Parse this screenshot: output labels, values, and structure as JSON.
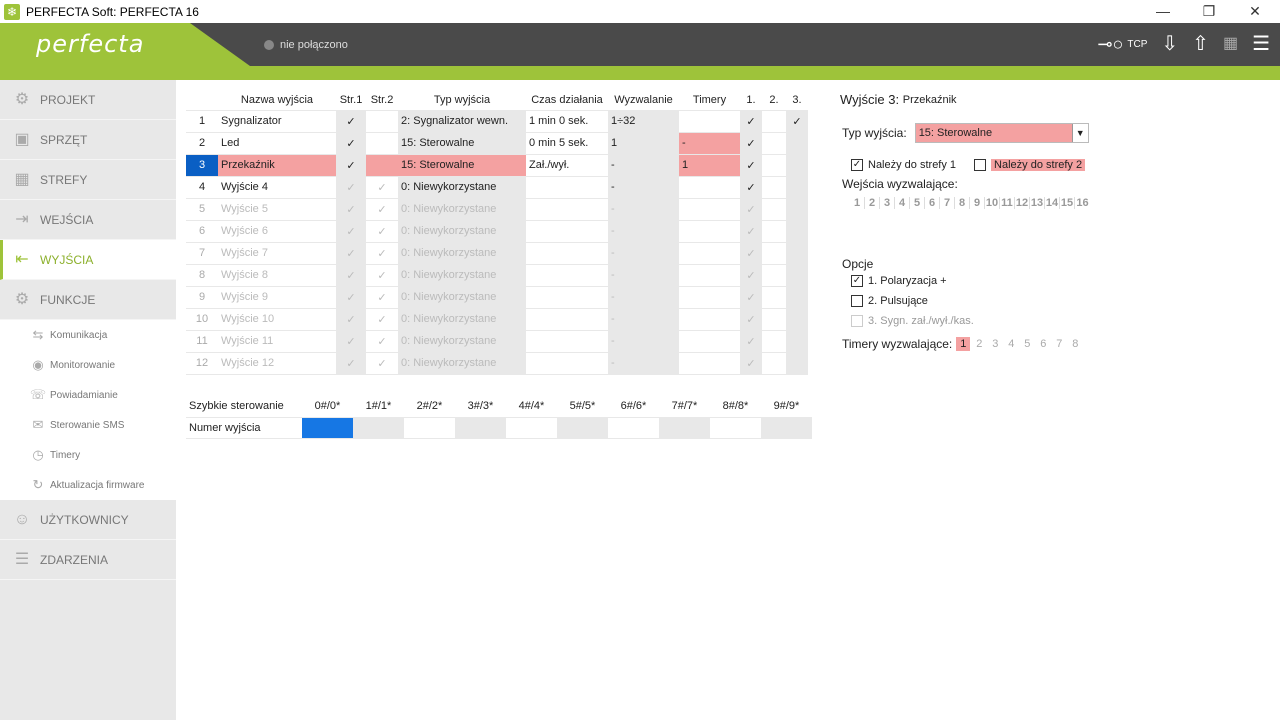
{
  "window": {
    "title": "PERFECTA Soft: PERFECTA 16"
  },
  "header": {
    "logo": "perfecta",
    "status": "nie połączono",
    "tcp_label": "TCP"
  },
  "sidebar": {
    "items": [
      {
        "label": "PROJEKT"
      },
      {
        "label": "SPRZĘT"
      },
      {
        "label": "STREFY"
      },
      {
        "label": "WEJŚCIA"
      },
      {
        "label": "WYJŚCIA"
      },
      {
        "label": "FUNKCJE"
      }
    ],
    "subitems": [
      {
        "label": "Komunikacja"
      },
      {
        "label": "Monitorowanie"
      },
      {
        "label": "Powiadamianie"
      },
      {
        "label": "Sterowanie SMS"
      },
      {
        "label": "Timery"
      },
      {
        "label": "Aktualizacja firmware"
      }
    ],
    "bottom": [
      {
        "label": "UŻYTKOWNICY"
      },
      {
        "label": "ZDARZENIA"
      }
    ]
  },
  "outputs_table": {
    "headers": [
      "",
      "Nazwa wyjścia",
      "Str.1",
      "Str.2",
      "Typ wyjścia",
      "Czas działania",
      "Wyzwalanie",
      "Timery",
      "1.",
      "2.",
      "3."
    ],
    "check": "✓",
    "rows": [
      {
        "num": "1",
        "name": "Sygnalizator",
        "type": "2: Sygnalizator wewn.",
        "time": "1 min 0 sek.",
        "trigger": "1÷32",
        "timers": ""
      },
      {
        "num": "2",
        "name": "Led",
        "type": "15: Sterowalne",
        "time": "0 min 5 sek.",
        "trigger": "1",
        "timers": "-"
      },
      {
        "num": "3",
        "name": "Przekaźnik",
        "type": "15: Sterowalne",
        "time": "Zał./wył.",
        "trigger": "-",
        "timers": "1"
      },
      {
        "num": "4",
        "name": "Wyjście  4",
        "type": "0: Niewykorzystane",
        "time": "",
        "trigger": "-",
        "timers": ""
      },
      {
        "num": "5",
        "name": "Wyjście  5",
        "type": "0: Niewykorzystane",
        "time": "",
        "trigger": "-",
        "timers": ""
      },
      {
        "num": "6",
        "name": "Wyjście  6",
        "type": "0: Niewykorzystane",
        "time": "",
        "trigger": "-",
        "timers": ""
      },
      {
        "num": "7",
        "name": "Wyjście  7",
        "type": "0: Niewykorzystane",
        "time": "",
        "trigger": "-",
        "timers": ""
      },
      {
        "num": "8",
        "name": "Wyjście  8",
        "type": "0: Niewykorzystane",
        "time": "",
        "trigger": "-",
        "timers": ""
      },
      {
        "num": "9",
        "name": "Wyjście  9",
        "type": "0: Niewykorzystane",
        "time": "",
        "trigger": "-",
        "timers": ""
      },
      {
        "num": "10",
        "name": "Wyjście 10",
        "type": "0: Niewykorzystane",
        "time": "",
        "trigger": "-",
        "timers": ""
      },
      {
        "num": "11",
        "name": "Wyjście 11",
        "type": "0: Niewykorzystane",
        "time": "",
        "trigger": "-",
        "timers": ""
      },
      {
        "num": "12",
        "name": "Wyjście 12",
        "type": "0: Niewykorzystane",
        "time": "",
        "trigger": "-",
        "timers": ""
      }
    ]
  },
  "quick_control": {
    "label": "Szybkie sterowanie",
    "row_label": "Numer wyjścia",
    "keys": [
      "0#/0*",
      "1#/1*",
      "2#/2*",
      "3#/3*",
      "4#/4*",
      "5#/5*",
      "6#/6*",
      "7#/7*",
      "8#/8*",
      "9#/9*"
    ]
  },
  "detail": {
    "title_prefix": "Wyjście 3:",
    "title_name": "Przekaźnik",
    "type_label": "Typ wyjścia:",
    "type_value": "15: Sterowalne",
    "zone1": "Należy do strefy 1",
    "zone2": "Należy do strefy 2",
    "inputs_label": "Wejścia wyzwalające:",
    "input_numbers": [
      "1",
      "2",
      "3",
      "4",
      "5",
      "6",
      "7",
      "8",
      "9",
      "10",
      "11",
      "12",
      "13",
      "14",
      "15",
      "16"
    ],
    "options_label": "Opcje",
    "opt1": "1. Polaryzacja +",
    "opt2": "2. Pulsujące",
    "opt3": "3. Sygn. zał./wył./kas.",
    "timers_label": "Timery wyzwalające:",
    "timer_numbers": [
      "1",
      "2",
      "3",
      "4",
      "5",
      "6",
      "7",
      "8"
    ]
  },
  "colors": {
    "accent": "#9ec33a",
    "highlight": "#f4a1a1",
    "selection": "#0a5fc4"
  }
}
